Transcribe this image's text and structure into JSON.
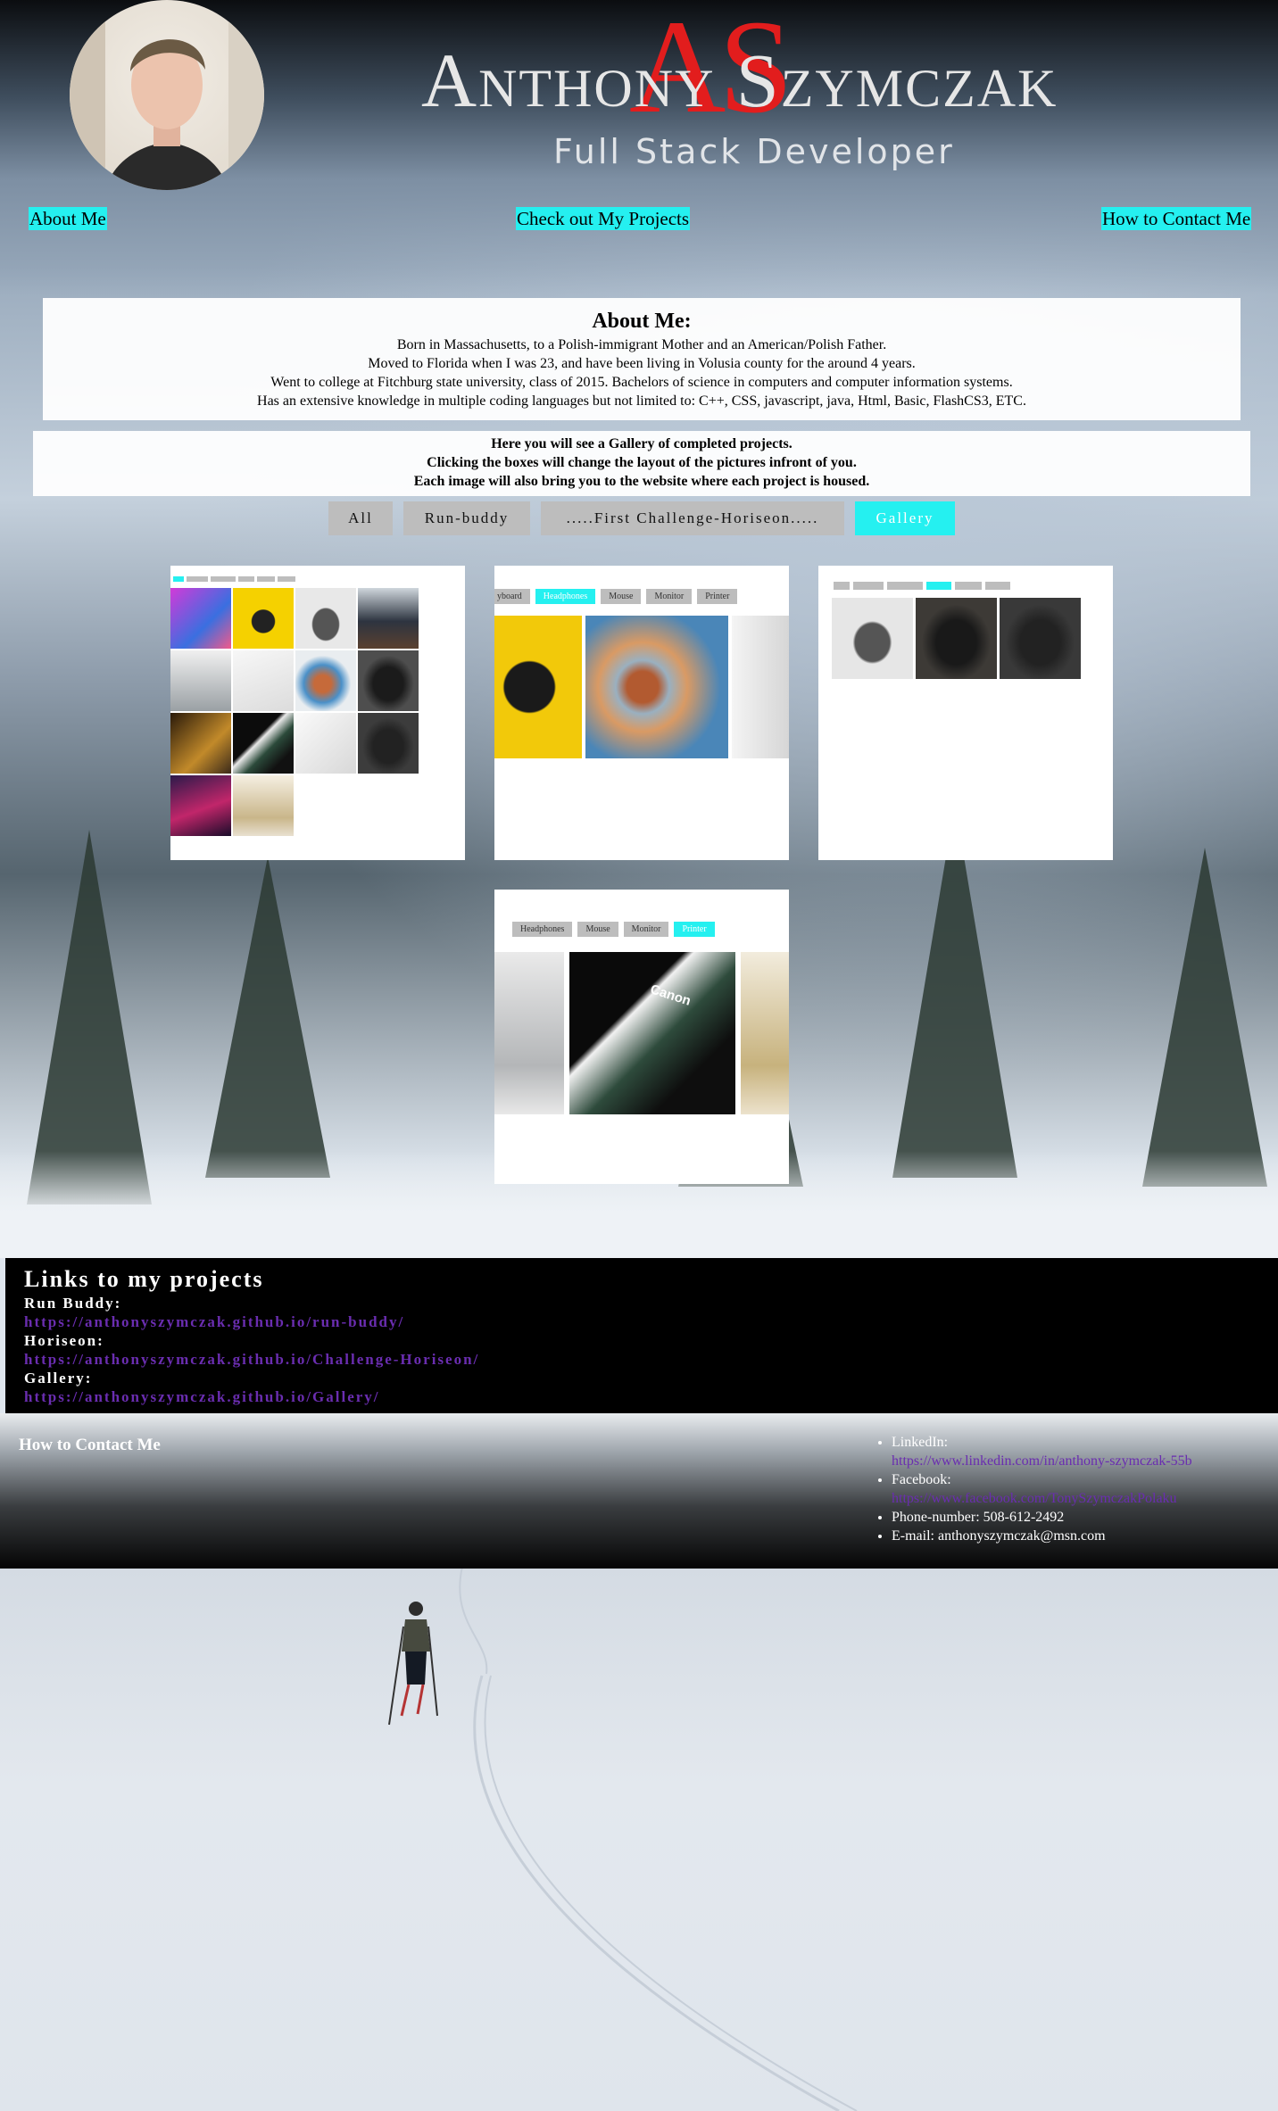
{
  "header": {
    "initials": "AS",
    "name": "Anthony Szymczak",
    "subtitle": "Full Stack Developer"
  },
  "nav": {
    "about": "About Me",
    "projects": "Check out My Projects",
    "contact": "How to Contact Me"
  },
  "about": {
    "heading": "About Me:",
    "lines": [
      "Born in Massachusetts, to a Polish-immigrant Mother and an American/Polish Father.",
      "Moved to Florida when I was 23, and have been living in Volusia county for the around 4 years.",
      "Went to college at Fitchburg state university, class of 2015. Bachelors of science in computers and computer information systems.",
      "Has an extensive knowledge in multiple coding languages but not limited to: C++, CSS, javascript, java, Html, Basic, FlashCS3, ETC."
    ]
  },
  "gallery": {
    "intro": [
      "Here you will see a Gallery of completed projects.",
      "Clicking the boxes will change the layout of the pictures infront of you.",
      "Each image will also bring you to the website where each project is housed."
    ],
    "filters": [
      "All",
      "Run-buddy",
      ".....First Challenge-Horiseon.....",
      "Gallery"
    ],
    "active_filter": "Gallery",
    "card2_tabs": [
      "yboard",
      "Headphones",
      "Mouse",
      "Monitor",
      "Printer"
    ],
    "card4_tabs": [
      "Headphones",
      "Mouse",
      "Monitor",
      "Printer"
    ],
    "card4_print_text": "Canon"
  },
  "links": {
    "heading": "Links to my projects",
    "items": [
      {
        "label": "Run Buddy:",
        "url": "https://anthonyszymczak.github.io/run-buddy/"
      },
      {
        "label": "Horiseon:",
        "url": "https://anthonyszymczak.github.io/Challenge-Horiseon/"
      },
      {
        "label": "Gallery:",
        "url": "https://anthonyszymczak.github.io/Gallery/"
      }
    ]
  },
  "contact": {
    "heading": "How to Contact Me",
    "linkedin_label": "LinkedIn:",
    "linkedin_url": "https://www.linkedin.com/in/anthony-szymczak-55b",
    "facebook_label": "Facebook:",
    "facebook_url": "https://www.facebook.com/TonySzymczakPolaku",
    "phone": "Phone-number: 508-612-2492",
    "email": "E-mail: anthonyszymczak@msn.com"
  },
  "colors": {
    "accent_cyan": "#25f0f0",
    "brand_red": "#e21d1d",
    "link_purple": "#6a2db0",
    "filter_grey": "#bdbdbd"
  }
}
